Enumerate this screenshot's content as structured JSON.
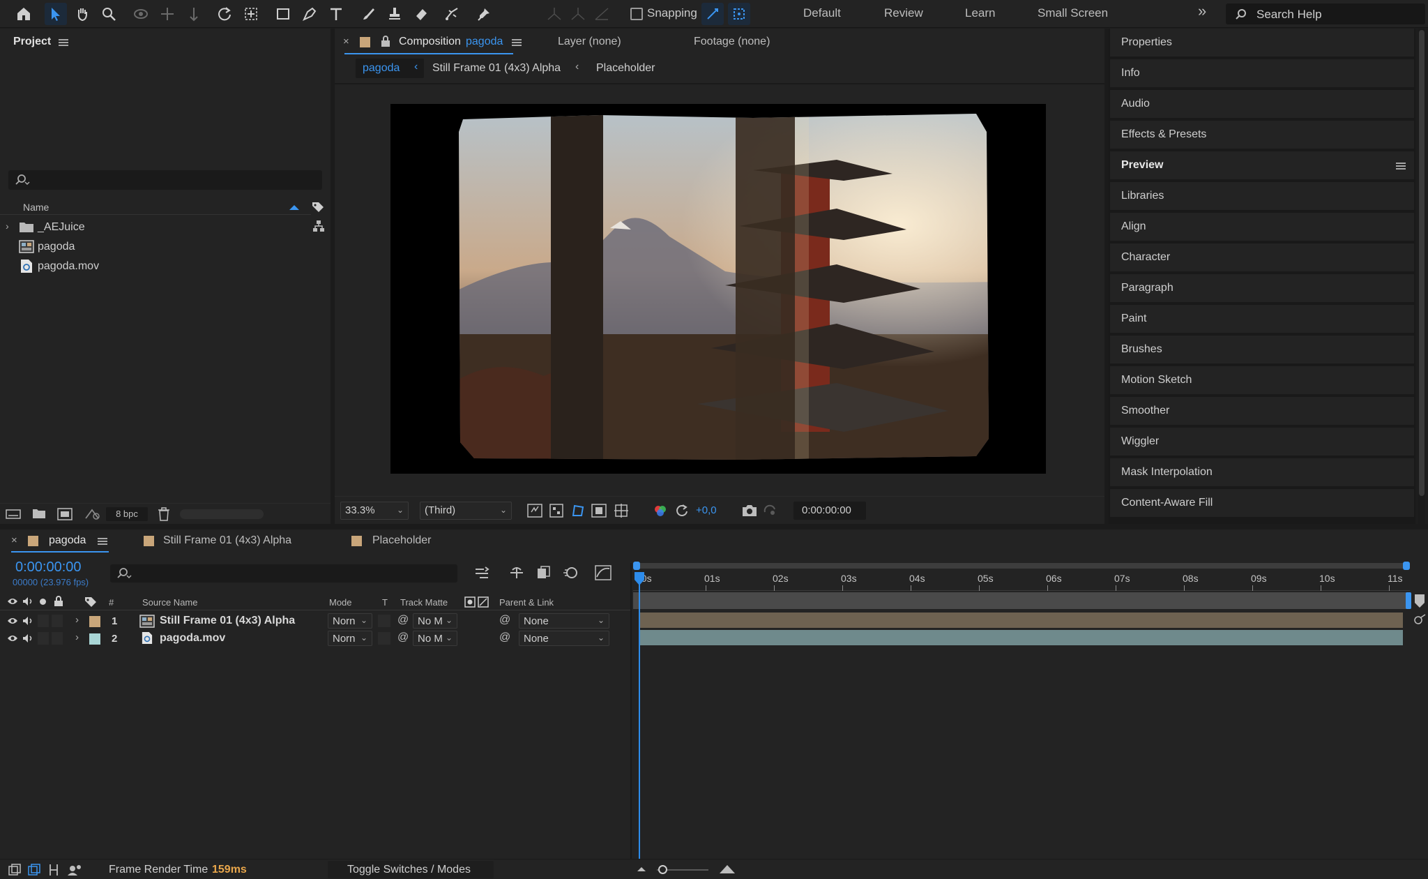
{
  "toolbar": {
    "tools": [
      "home-icon",
      "selection-tool-icon",
      "hand-tool-icon",
      "zoom-tool-icon",
      "orbit-camera-icon",
      "pan-camera-icon",
      "dolly-camera-icon",
      "rotation-tool-icon",
      "pan-behind-icon",
      "rectangle-tool-icon",
      "pen-tool-icon",
      "type-tool-icon",
      "brush-tool-icon",
      "clone-stamp-icon",
      "eraser-tool-icon",
      "roto-brush-icon",
      "puppet-pin-icon"
    ],
    "snapping_label": "Snapping",
    "workspaces": [
      "Default",
      "Review",
      "Learn",
      "Small Screen"
    ],
    "more": "»",
    "search_placeholder": "Search Help"
  },
  "project": {
    "title": "Project",
    "name_header": "Name",
    "items": [
      {
        "label": "_AEJuice",
        "type": "folder"
      },
      {
        "label": "pagoda",
        "type": "composition"
      },
      {
        "label": "pagoda.mov",
        "type": "footage"
      }
    ],
    "bpc": "8 bpc"
  },
  "viewer": {
    "tab_prefix": "Composition",
    "tab_comp": "pagoda",
    "layer_tab": "Layer (none)",
    "footage_tab": "Footage (none)",
    "breadcrumbs": [
      "pagoda",
      "Still Frame 01 (4x3) Alpha",
      "Placeholder"
    ],
    "zoom": "33.3%",
    "resolution": "(Third)",
    "exposure": "+0,0",
    "timecode": "0:00:00:00"
  },
  "right_panel": {
    "items": [
      "Properties",
      "Info",
      "Audio",
      "Effects & Presets",
      "Preview",
      "Libraries",
      "Align",
      "Character",
      "Paragraph",
      "Paint",
      "Brushes",
      "Motion Sketch",
      "Smoother",
      "Wiggler",
      "Mask Interpolation",
      "Content-Aware Fill"
    ]
  },
  "timeline": {
    "tabs": [
      "pagoda",
      "Still Frame 01 (4x3) Alpha",
      "Placeholder"
    ],
    "timecode": "0:00:00:00",
    "frames": "00000 (23.976 fps)",
    "columns": {
      "hash": "#",
      "source": "Source Name",
      "mode": "Mode",
      "t": "T",
      "matte": "Track Matte",
      "parent": "Parent & Link"
    },
    "ruler": [
      "00s",
      "01s",
      "02s",
      "03s",
      "04s",
      "05s",
      "06s",
      "07s",
      "08s",
      "09s",
      "10s",
      "11s"
    ],
    "layers": [
      {
        "num": "1",
        "name": "Still Frame 01 (4x3) Alpha",
        "mode": "Norn",
        "matte": "No M",
        "parent": "None",
        "label_color": "#c9a67a",
        "bar_color": "#6e6251"
      },
      {
        "num": "2",
        "name": "pagoda.mov",
        "mode": "Norn",
        "matte": "No M",
        "parent": "None",
        "label_color": "#a9d6d6",
        "bar_color": "#6f8a8c"
      }
    ]
  },
  "statusbar": {
    "render_label": "Frame Render Time",
    "render_value": "159ms",
    "toggle": "Toggle Switches / Modes"
  },
  "colors": {
    "accent": "#2d8ceb",
    "highlight_text": "#e8a64b"
  }
}
